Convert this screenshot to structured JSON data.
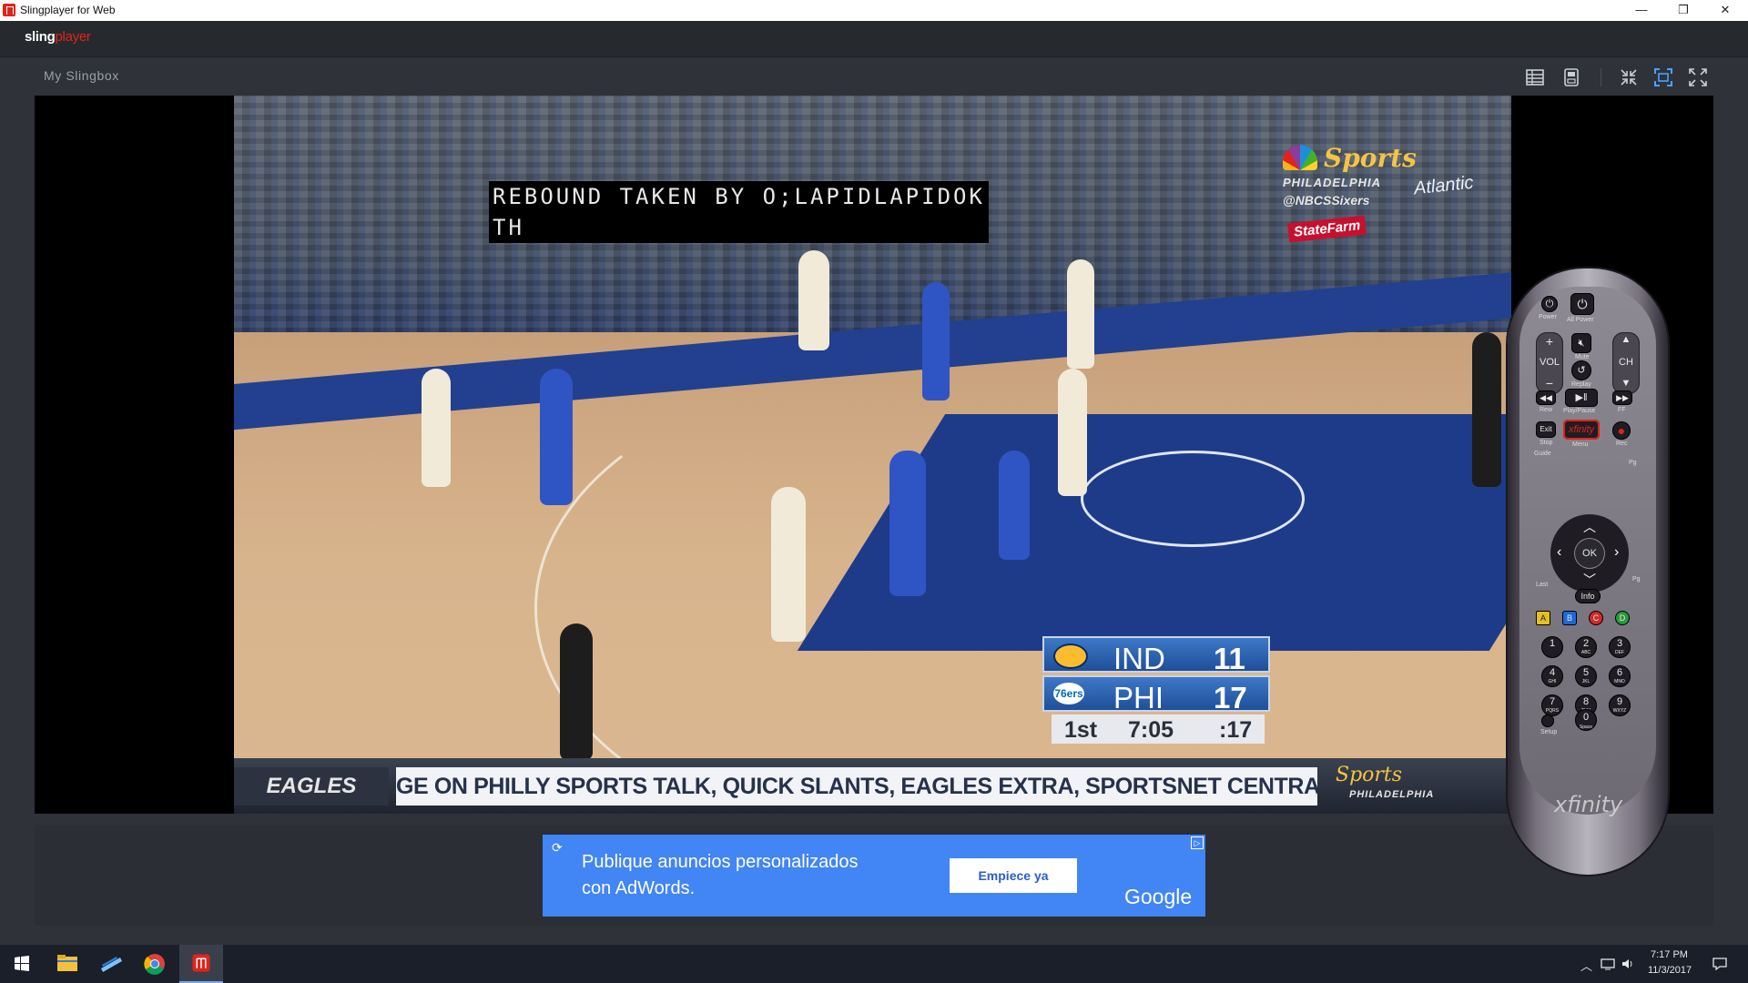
{
  "window": {
    "title": "Slingplayer for Web",
    "minimize": "—",
    "restore": "❐",
    "close": "✕"
  },
  "app": {
    "logo_part1": "sling",
    "logo_part2": "player"
  },
  "main": {
    "box_name": "My Slingbox"
  },
  "toolbar": {
    "icons": [
      "guide-grid-icon",
      "remote-save-icon",
      "shrink-icon",
      "fit-screen-icon",
      "fullscreen-icon"
    ]
  },
  "video": {
    "caption_line1": "REBOUND TAKEN BY O;LAPIDLAPIDOK",
    "caption_line2": "TH",
    "network_brand": "Sports",
    "network_city": "PHILADELPHIA",
    "network_handle": "@NBCSSixers",
    "arena_banner": "Atlantic",
    "sponsor_banner": "StateFarm",
    "scoreboard": {
      "team1": "IND",
      "team1_score": "11",
      "team2": "PHI",
      "team2_score": "17",
      "team2_logo": "76ers",
      "period": "1st",
      "clock": "7:05",
      "shot_clock": ":17"
    },
    "ticker_label": "EAGLES",
    "ticker_text": "GE ON PHILLY SPORTS TALK, QUICK SLANTS, EAGLES EXTRA, SPORTSNET CENTRAL & ON NBC",
    "ticker_brand": "Sports",
    "ticker_brand_city": "PHILADELPHIA"
  },
  "ad": {
    "line1": "Publique anuncios personalizados",
    "line2": "con AdWords.",
    "button": "Empiece ya",
    "brand": "Google"
  },
  "remote": {
    "power": "Power",
    "all_power": "All Power",
    "vol": "VOL",
    "ch": "CH",
    "mute": "Mute",
    "replay": "Replay",
    "rew": "Rew",
    "play_pause": "Play/Pause",
    "ff": "FF",
    "exit": "Exit",
    "stop": "Stop",
    "menu": "Menu",
    "rec": "Rec",
    "menu_brand": "xfinity",
    "guide": "Guide",
    "pg": "Pg",
    "last": "Last",
    "ok": "OK",
    "info": "Info",
    "color_keys": [
      "A",
      "B",
      "C",
      "D"
    ],
    "digits": [
      {
        "n": "1",
        "s": ""
      },
      {
        "n": "2",
        "s": "ABC"
      },
      {
        "n": "3",
        "s": "DEF"
      },
      {
        "n": "4",
        "s": "GHI"
      },
      {
        "n": "5",
        "s": "JKL"
      },
      {
        "n": "6",
        "s": "MNO"
      },
      {
        "n": "7",
        "s": "PQRS"
      },
      {
        "n": "8",
        "s": "TUV"
      },
      {
        "n": "9",
        "s": "WXYZ"
      }
    ],
    "zero": "0",
    "zero_sub": "Space",
    "setup": "Setup",
    "brand": "xfinity"
  },
  "taskbar": {
    "time": "7:17 PM",
    "date": "11/3/2017"
  },
  "colors": {
    "accent": "#e2231a",
    "ad_blue": "#4285f4",
    "app_bg": "#2f3238"
  }
}
